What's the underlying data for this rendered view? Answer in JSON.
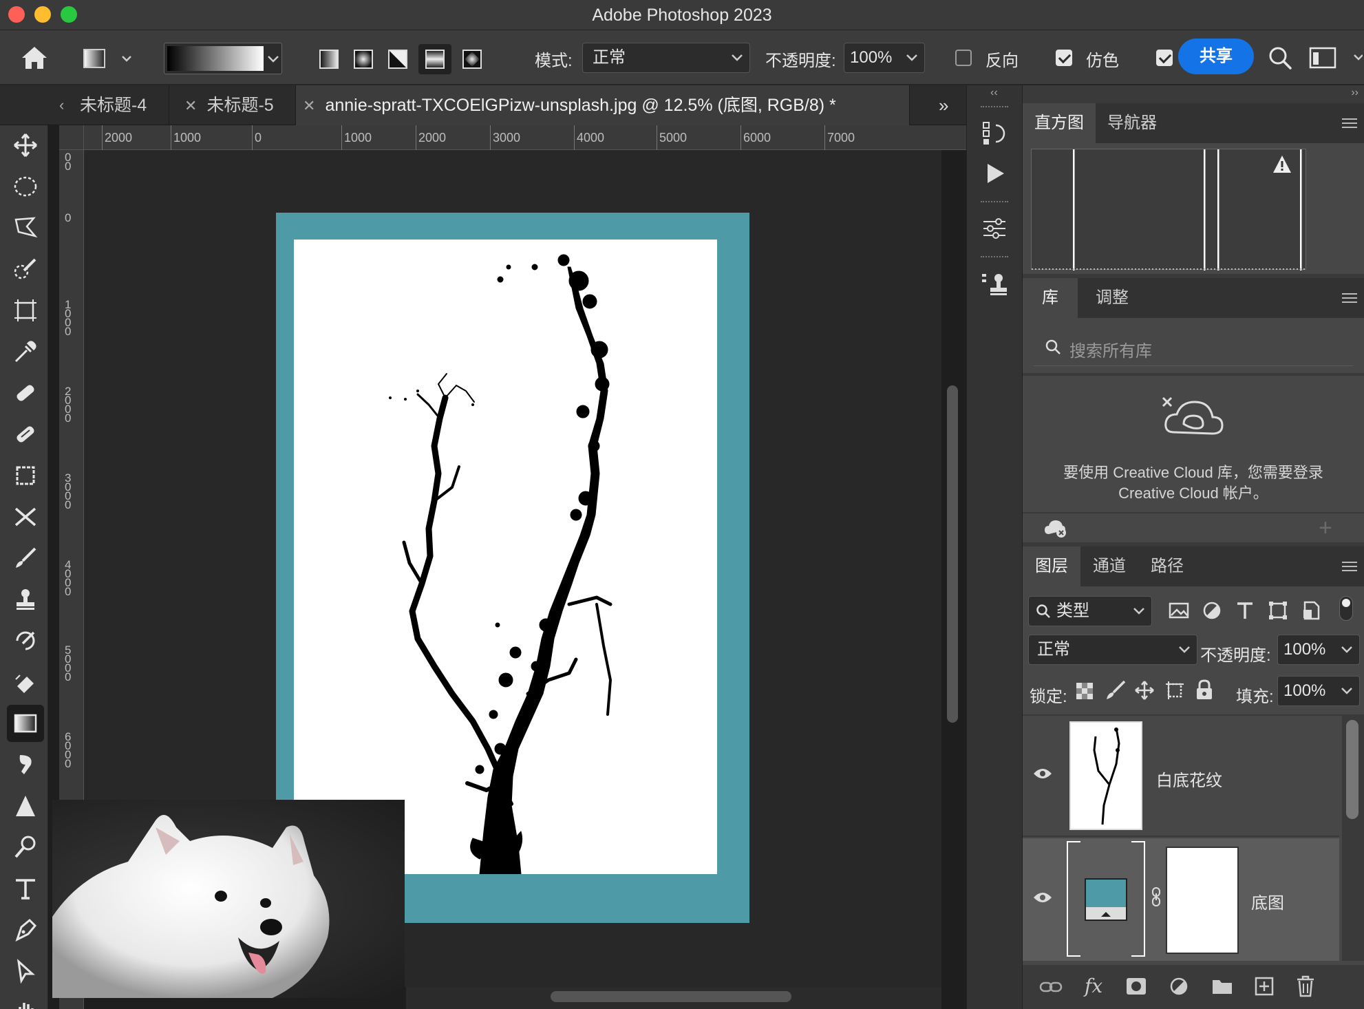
{
  "app": {
    "title": "Adobe Photoshop 2023",
    "accent_color": "#1473e6",
    "canvas_color": "#4e9ba7"
  },
  "options_bar": {
    "mode_label": "模式:",
    "mode_value": "正常",
    "opacity_label": "不透明度:",
    "opacity_value": "100%",
    "reverse_label": "反向",
    "dither_label": "仿色",
    "share_label": "共享"
  },
  "tabs": [
    {
      "label": "未标题-4",
      "active": false
    },
    {
      "label": "未标题-5",
      "active": false
    },
    {
      "label": "annie-spratt-TXCOElGPizw-unsplash.jpg @ 12.5% (底图, RGB/8) *",
      "active": true
    }
  ],
  "ruler_top": [
    "2000",
    "1000",
    "0",
    "1000",
    "2000",
    "3000",
    "4000",
    "5000",
    "6000",
    "7000"
  ],
  "ruler_left": [
    "0 0",
    "0",
    "1 0 0 0",
    "2 0 0 0",
    "3 0 0 0",
    "4 0 0 0",
    "5 0 0 0",
    "6 0 0 0"
  ],
  "histogram_panel": {
    "tabs": [
      "直方图",
      "导航器"
    ]
  },
  "library_panel": {
    "tabs": [
      "库",
      "调整"
    ],
    "search_placeholder": "搜索所有库",
    "message_line1": "要使用 Creative Cloud 库，您需要登录",
    "message_line2": "Creative Cloud 帐户。"
  },
  "layers_panel": {
    "tabs": [
      "图层",
      "通道",
      "路径"
    ],
    "filter_label": "类型",
    "blend_mode": "正常",
    "opacity_label": "不透明度:",
    "opacity_value": "100%",
    "lock_label": "锁定:",
    "fill_label": "填充:",
    "fill_value": "100%",
    "layers": [
      {
        "name": "白底花纹",
        "visible": true
      },
      {
        "name": "底图",
        "visible": true
      }
    ]
  }
}
